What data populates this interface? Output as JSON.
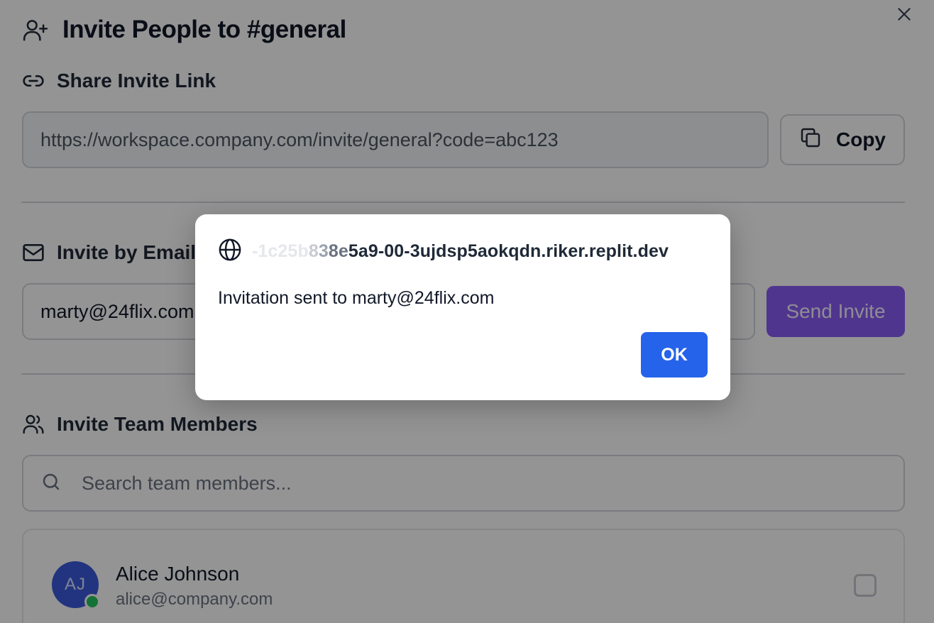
{
  "header": {
    "title": "Invite People to #general",
    "title_icon": "user-plus-icon",
    "close_icon": "close-icon"
  },
  "share_link": {
    "heading": "Share Invite Link",
    "heading_icon": "link-icon",
    "url": "https://workspace.company.com/invite/general?code=abc123",
    "copy_label": "Copy",
    "copy_icon": "copy-icon"
  },
  "invite_email": {
    "heading": "Invite by Email",
    "heading_icon": "mail-icon",
    "value": "marty@24flix.com",
    "send_label": "Send Invite"
  },
  "team": {
    "heading": "Invite Team Members",
    "heading_icon": "users-icon",
    "search_placeholder": "Search team members...",
    "search_icon": "search-icon",
    "members": [
      {
        "initials": "AJ",
        "name": "Alice Johnson",
        "email": "alice@company.com",
        "online": true,
        "selected": false
      }
    ]
  },
  "alert": {
    "origin_prefix": "-1c25b",
    "origin_mid1": "8",
    "origin_mid2": "3",
    "origin_mid3": "8e",
    "origin_main": "5a9-00-3ujdsp5aokqdn.riker.replit.dev",
    "origin_icon": "globe-icon",
    "message": "Invitation sent to marty@24flix.com",
    "ok_label": "OK"
  },
  "colors": {
    "primary_button": "#8b5cf6",
    "ok_button": "#2563eb",
    "avatar": "#3b5bdb",
    "presence_online": "#22c55e"
  }
}
